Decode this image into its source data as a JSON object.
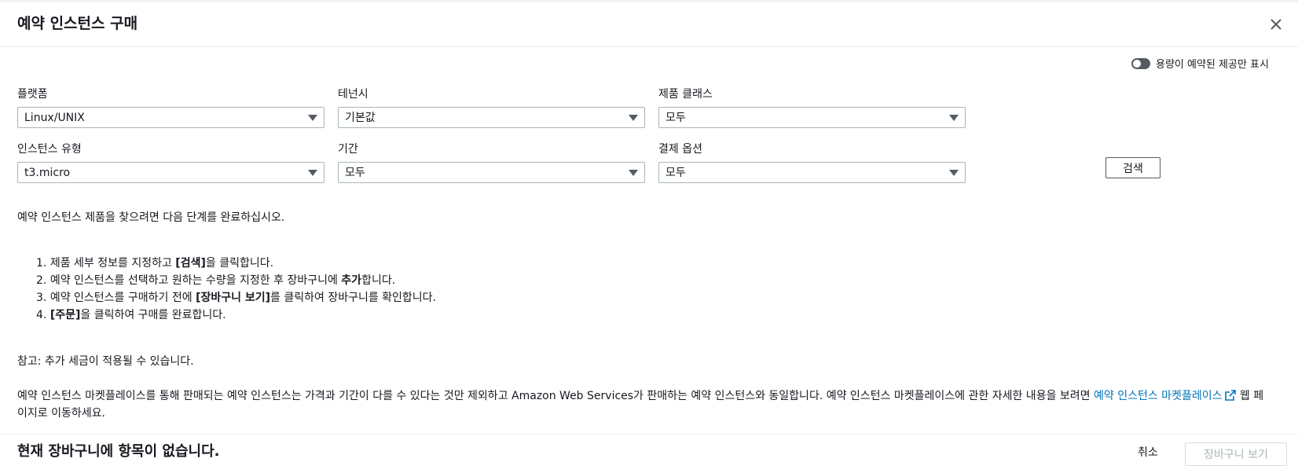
{
  "header": {
    "title": "예약 인스턴스 구매"
  },
  "capacity_toggle": {
    "label": "용량이 예약된 제공만 표시",
    "on": false
  },
  "filters": {
    "platform": {
      "label": "플랫폼",
      "value": "Linux/UNIX"
    },
    "tenancy": {
      "label": "테넌시",
      "value": "기본값"
    },
    "offering_class": {
      "label": "제품 클래스",
      "value": "모두"
    },
    "instance_type": {
      "label": "인스턴스 유형",
      "value": "t3.micro"
    },
    "term": {
      "label": "기간",
      "value": "모두"
    },
    "payment_option": {
      "label": "결제 옵션",
      "value": "모두"
    }
  },
  "search_button": "검색",
  "instructions": {
    "intro": "예약 인스턴스 제품을 찾으려면 다음 단계를 완료하십시오.",
    "steps": [
      {
        "n": "1.",
        "pre": "제품 세부 정보를 지정하고 ",
        "bold": "[검색]",
        "post": "을 클릭합니다."
      },
      {
        "n": "2.",
        "pre": "예약 인스턴스를 선택하고 원하는 수량을 지정한 후 장바구니에 ",
        "bold": "추가",
        "post": "합니다."
      },
      {
        "n": "3.",
        "pre": "예약 인스턴스를 구매하기 전에 ",
        "bold": "[장바구니 보기]",
        "post": "를 클릭하여 장바구니를 확인합니다."
      },
      {
        "n": "4.",
        "pre": "",
        "bold": "[주문]",
        "post": "을 클릭하여 구매를 완료합니다."
      }
    ],
    "note": "참고: 추가 세금이 적용될 수 있습니다.",
    "marketplace_text": "예약 인스턴스 마켓플레이스를 통해 판매되는 예약 인스턴스는 가격과 기간이 다를 수 있다는 것만 제외하고 Amazon Web Services가 판매하는 예약 인스턴스와 동일합니다. 예약 인스턴스 마켓플레이스에 관한 자세한 내용을 보려면 ",
    "marketplace_link": "예약 인스턴스 마켓플레이스",
    "marketplace_suffix": " 웹 페이지로 이동하세요."
  },
  "footer": {
    "cart_status": "현재 장바구니에 항목이 없습니다.",
    "cancel": "취소",
    "view_cart": "장바구니 보기"
  },
  "colors": {
    "link": "#0073bb",
    "border": "#aab7b8",
    "toggle_off": "#545b64"
  },
  "icons": {
    "close": "close-icon",
    "external": "external-link-icon",
    "dropdown": "caret-down-icon"
  }
}
